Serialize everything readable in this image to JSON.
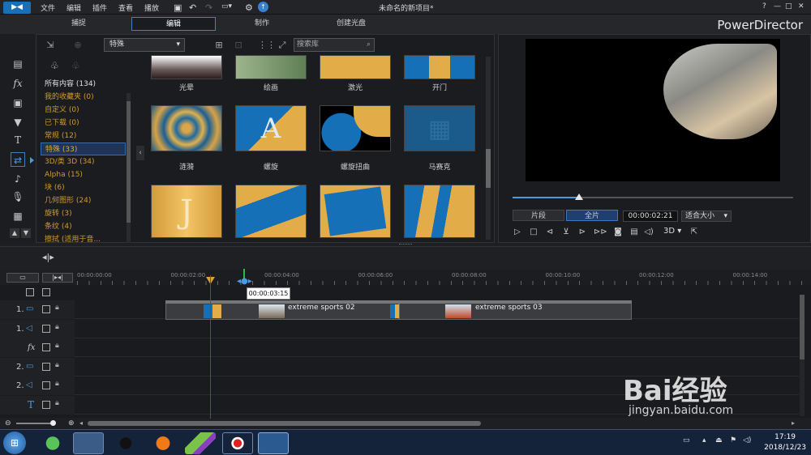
{
  "menubar": {
    "items": [
      "文件",
      "编辑",
      "插件",
      "查看",
      "播放"
    ],
    "title": "未命名的新项目*",
    "window_buttons": [
      "?",
      "—",
      "□",
      "✕"
    ]
  },
  "tabs": {
    "capture": "捕捉",
    "edit": "编辑",
    "produce": "制作",
    "disc": "创建光盘"
  },
  "brand": "PowerDirector",
  "library": {
    "dropdown": "特殊",
    "search_placeholder": "搜索库",
    "categories": [
      {
        "label": "所有内容 (134)",
        "selected": false
      },
      {
        "label": "我的收藏夹 (0)",
        "selected": false
      },
      {
        "label": "自定义 (0)",
        "selected": false
      },
      {
        "label": "已下载 (0)",
        "selected": false
      },
      {
        "label": "常规 (12)",
        "selected": false
      },
      {
        "label": "特殊 (33)",
        "selected": true
      },
      {
        "label": "3D/类 3D (34)",
        "selected": false
      },
      {
        "label": "Alpha (15)",
        "selected": false
      },
      {
        "label": "块 (6)",
        "selected": false
      },
      {
        "label": "几何图形 (24)",
        "selected": false
      },
      {
        "label": "旋转 (3)",
        "selected": false
      },
      {
        "label": "条纹 (4)",
        "selected": false
      },
      {
        "label": "擦拭 (适用于音...",
        "selected": false
      }
    ],
    "effects_row1": [
      "光晕",
      "绘画",
      "激光",
      "开门"
    ],
    "effects_row2": [
      "涟漪",
      "螺旋",
      "螺旋扭曲",
      "马赛克"
    ]
  },
  "preview": {
    "mode_clip": "片段",
    "mode_movie": "全片",
    "timecode": "00:00:02:21",
    "fit": "适合大小",
    "threed": "3D"
  },
  "timeline": {
    "ticks": [
      "00:00:00:00",
      "00:00:02:00",
      "00:00:04:00",
      "00:00:06:00",
      "00:00:08:00",
      "00:00:10:00",
      "00:00:12:00",
      "00:00:14:00"
    ],
    "tooltip": "00:00:03:15",
    "tracks": [
      {
        "name": "1."
      },
      {
        "name": "1."
      },
      {
        "name": "fx"
      },
      {
        "name": "2."
      },
      {
        "name": "2."
      },
      {
        "name": "T"
      }
    ],
    "clips": [
      "extreme sports 02",
      "extreme sports 03"
    ]
  },
  "taskbar": {
    "time": "17:19",
    "date": "2018/12/23"
  },
  "watermark": {
    "logo": "Bai经验",
    "url": "jingyan.baidu.com"
  }
}
